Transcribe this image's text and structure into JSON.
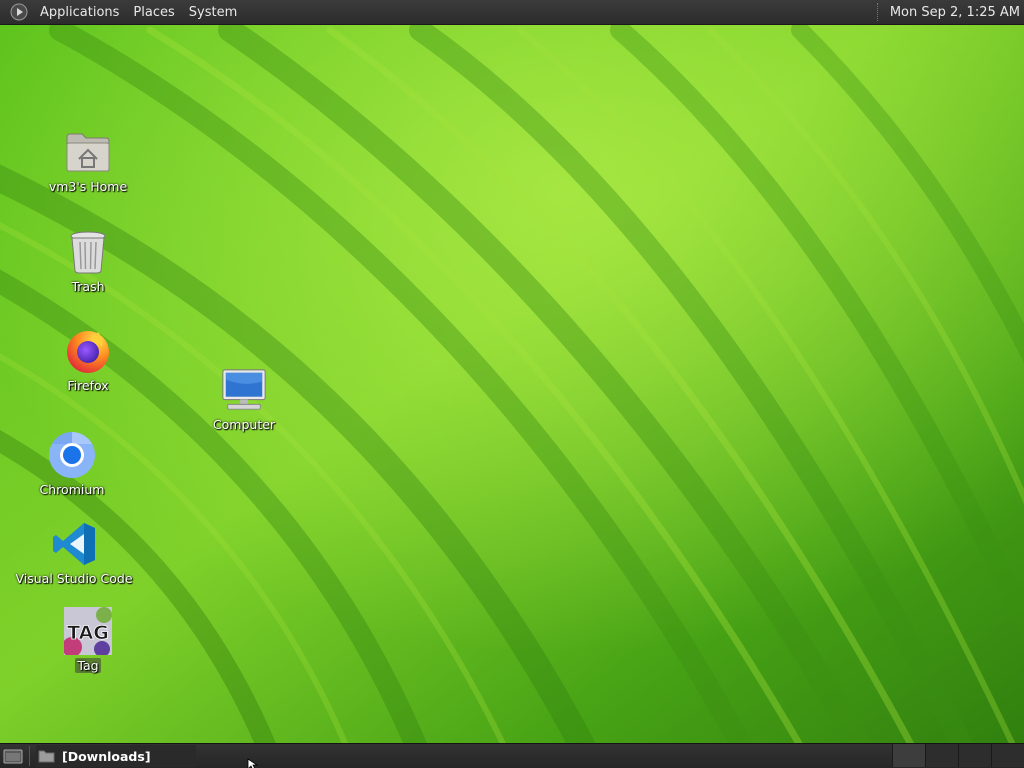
{
  "top_panel": {
    "menus": [
      {
        "label": "Applications"
      },
      {
        "label": "Places"
      },
      {
        "label": "System"
      }
    ],
    "clock": "Mon Sep  2, 1:25 AM"
  },
  "desktop": {
    "icons": [
      {
        "label": "vm3's Home",
        "icon": "home-folder-icon"
      },
      {
        "label": "Trash",
        "icon": "trash-icon"
      },
      {
        "label": "Firefox",
        "icon": "firefox-icon"
      },
      {
        "label": "Computer",
        "icon": "computer-icon"
      },
      {
        "label": "Chromium",
        "icon": "chromium-icon"
      },
      {
        "label": "Visual Studio Code",
        "icon": "vscode-icon"
      },
      {
        "label": "Tag",
        "icon": "tag-image-icon",
        "image_text": "TAG"
      }
    ]
  },
  "bottom_panel": {
    "tasks": [
      {
        "label": "[Downloads]",
        "icon": "folder-icon"
      }
    ],
    "workspace_count": 4,
    "active_workspace": 1
  },
  "colors": {
    "panel_bg": "#2c2c2c",
    "wallpaper_green": "#4fa81a"
  }
}
